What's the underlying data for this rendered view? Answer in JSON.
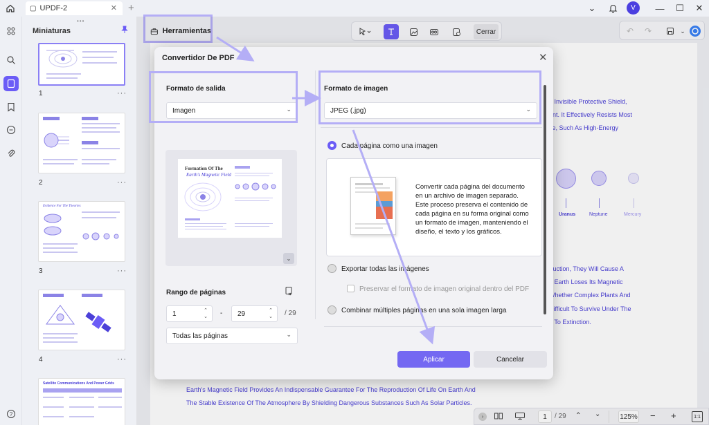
{
  "window": {
    "tab_title": "UPDF-2",
    "avatar_initial": "V"
  },
  "thumbnails": {
    "title": "Miniaturas",
    "pages": [
      "1",
      "2",
      "3",
      "4"
    ],
    "more": "···",
    "page2_heading": "",
    "page3_heading": "Evidence For The Theories",
    "page5_heading": "Satellite Communications And Power Grids"
  },
  "toolbar": {
    "tools_label": "Herramientas",
    "close_label": "Cerrar"
  },
  "document": {
    "right_lines": [
      "d Invisible Protective Shield,",
      "ent. It Effectively Resists Most",
      "se, Such As High-Energy"
    ],
    "planets": [
      "Uranus",
      "Neptune",
      "Mercury"
    ],
    "lower_lines": [
      "truction, They Will Cause A",
      "e Earth Loses Its Magnetic",
      "Whether Complex Plants And",
      "Difficult To Survive Under The",
      "p To Extinction."
    ],
    "bottom_lines": [
      "Earth's Magnetic Field Provides An Indispensable Guarantee For The Reproduction Of Life On Earth And",
      "The Stable Existence Of The Atmosphere By Shielding Dangerous Substances Such As Solar Particles."
    ]
  },
  "dialog": {
    "title": "Convertidor De PDF",
    "output_format_label": "Formato de salida",
    "output_format_value": "Imagen",
    "preview_title_line1": "Formation Of The",
    "preview_title_line2": "Earth's Magnetic Field",
    "page_range_label": "Rango de páginas",
    "range_from": "1",
    "range_sep": "-",
    "range_to": "29",
    "range_total": "/ 29",
    "pages_option": "Todas las páginas",
    "image_format_label": "Formato de imagen",
    "image_format_value": "JPEG (.jpg)",
    "option_each_page": "Cada página como una imagen",
    "description": "Convertir cada página del documento en un archivo de imagen separado. Este proceso preserva el contenido de cada página en su forma original como un formato de imagen, manteniendo el diseño, el texto y los gráficos.",
    "option_export_images": "Exportar todas las imágenes",
    "option_preserve_format": "Preservar el formato de imagen original dentro del PDF",
    "option_combine": "Combinar múltiples páginas en una sola imagen larga",
    "apply": "Aplicar",
    "cancel": "Cancelar"
  },
  "statusbar": {
    "page_current": "1",
    "page_total": "/ 29",
    "zoom": "125%",
    "fit_label": "1:1"
  },
  "colors": {
    "accent": "#6b5cf6",
    "highlight": "#b4aef6",
    "doc_text": "#4b40d8"
  }
}
